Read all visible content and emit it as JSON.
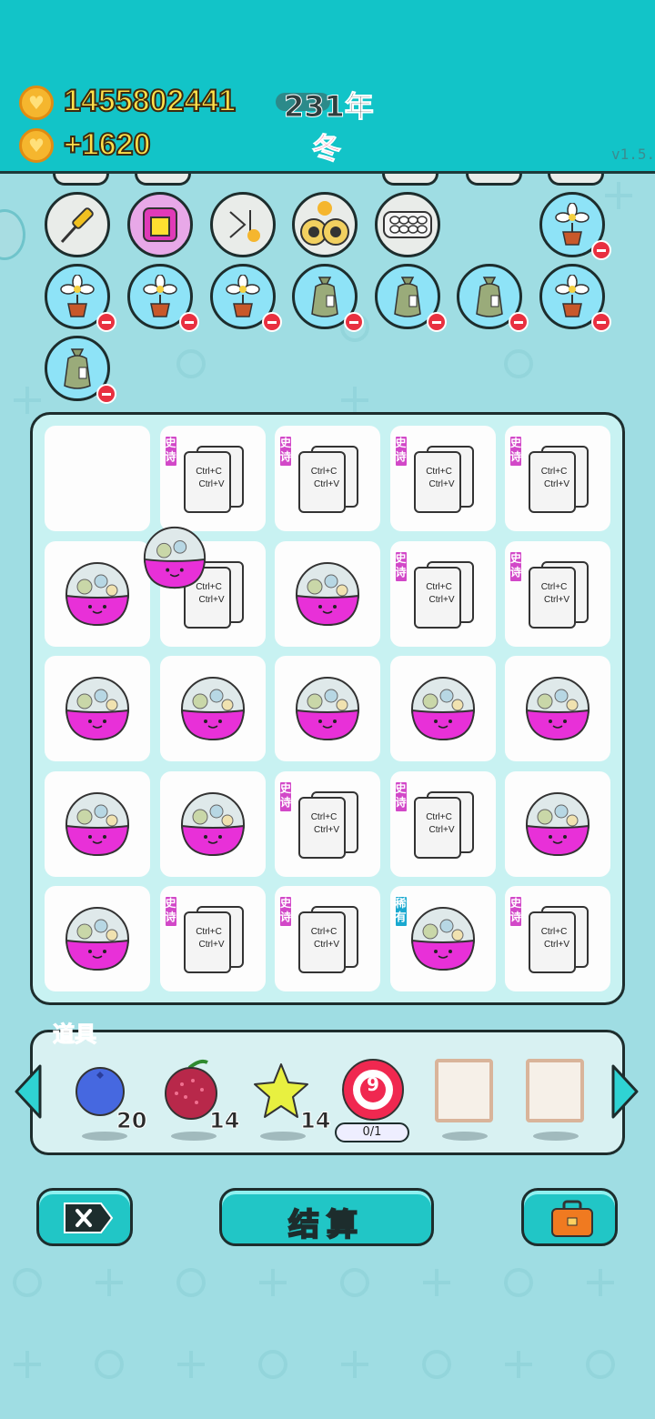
{
  "header": {
    "coins_total": "1455802441",
    "coins_gain": "+1620",
    "year": "231年",
    "season": "冬",
    "version": "v1.5.4"
  },
  "inventory": {
    "row1": [
      {
        "icon": "screwdriver-icon",
        "style": "gray",
        "removable": false
      },
      {
        "icon": "pink-box-icon",
        "style": "pink",
        "removable": false
      },
      {
        "icon": "skip-forward-icon",
        "style": "gray",
        "removable": false
      },
      {
        "icon": "owl-mask-icon",
        "style": "gray",
        "removable": false
      },
      {
        "icon": "egg-tray-icon",
        "style": "gray",
        "removable": false
      },
      {
        "icon": "flower-pot-icon",
        "style": "blue",
        "removable": true
      }
    ],
    "row2": [
      {
        "icon": "flower-pot-icon",
        "removable": true
      },
      {
        "icon": "flower-pot-icon",
        "removable": true
      },
      {
        "icon": "flower-pot-icon",
        "removable": true
      },
      {
        "icon": "sack-icon",
        "removable": true
      },
      {
        "icon": "sack-icon",
        "removable": true
      },
      {
        "icon": "sack-icon",
        "removable": true
      },
      {
        "icon": "flower-pot-icon",
        "removable": true
      }
    ],
    "row3": [
      {
        "icon": "sack-icon",
        "removable": true
      }
    ]
  },
  "board": {
    "card_line1": "Ctrl+C",
    "card_line2": "Ctrl+V",
    "tag_epic": "史诗",
    "tag_rare": "稀有",
    "cells": [
      "empty",
      "card-epic",
      "card-epic",
      "card-epic",
      "card-epic",
      "ball",
      "card",
      "ball",
      "card-epic",
      "card-epic",
      "ball",
      "ball",
      "ball",
      "ball",
      "ball",
      "ball",
      "ball",
      "card-epic",
      "card-epic",
      "ball",
      "ball",
      "card-epic",
      "card-epic",
      "ball-rare",
      "card-epic"
    ]
  },
  "tools": {
    "label": "道具",
    "items": [
      {
        "icon": "blueberry-icon",
        "count": "20"
      },
      {
        "icon": "bayberry-icon",
        "count": "14"
      },
      {
        "icon": "star-icon",
        "count": "14"
      },
      {
        "icon": "target-icon",
        "badge": "9",
        "progress": "0/1"
      },
      {
        "icon": "empty-frame-icon"
      },
      {
        "icon": "empty-frame-icon"
      }
    ]
  },
  "buttons": {
    "settle": "结算"
  },
  "colors": {
    "header": "#12c4c8",
    "background": "#9fdde3",
    "coin_text": "#ffe04a",
    "season": "#f0306a",
    "epic_tag": "#d248c8",
    "rare_tag": "#1aa9d0",
    "capsule": "#e830d8"
  }
}
